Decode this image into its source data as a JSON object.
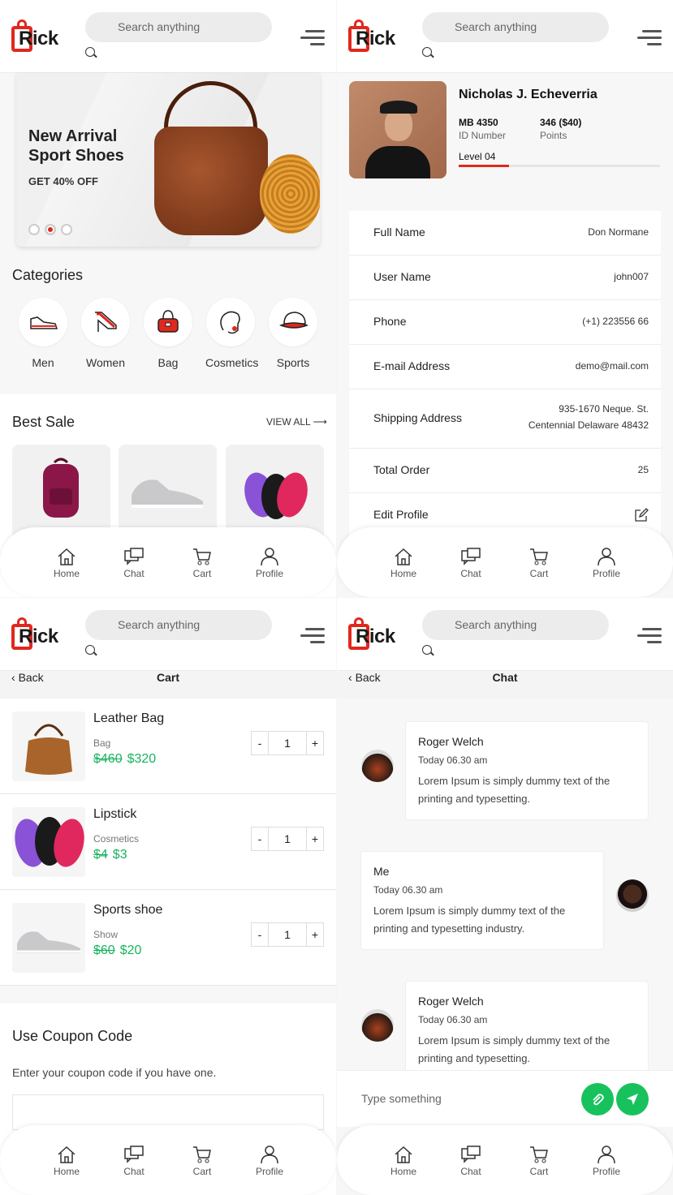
{
  "brand": {
    "logo_text": "Rick"
  },
  "search": {
    "placeholder": "Search anything"
  },
  "nav": {
    "home": "Home",
    "chat": "Chat",
    "cart": "Cart",
    "profile": "Profile"
  },
  "home": {
    "banner": {
      "title": "New Arrival Sport Shoes",
      "subtitle": "GET 40% OFF",
      "active_slide": 2,
      "slide_count": 3
    },
    "categories_title": "Categories",
    "categories": [
      {
        "label": "Men",
        "icon": "shoe-icon"
      },
      {
        "label": "Women",
        "icon": "heel-icon"
      },
      {
        "label": "Bag",
        "icon": "bag-icon"
      },
      {
        "label": "Cosmetics",
        "icon": "face-icon"
      },
      {
        "label": "Sports",
        "icon": "cap-icon"
      }
    ],
    "best_sale_title": "Best Sale",
    "view_all": "VIEW ALL ⟶"
  },
  "profile": {
    "name": "Nicholas J. Echeverria",
    "id_value": "MB 4350",
    "id_label": "ID Number",
    "points_value": "346 ($40)",
    "points_label": "Points",
    "level": "Level 04",
    "level_progress": 0.25,
    "rows": [
      {
        "label": "Full Name",
        "value": "Don Normane"
      },
      {
        "label": "User Name",
        "value": "john007"
      },
      {
        "label": "Phone",
        "value": "(+1) 223556 66"
      },
      {
        "label": "E-mail Address",
        "value": "demo@mail.com"
      },
      {
        "label": "Shipping Address",
        "value_line1": "935-1670 Neque. St.",
        "value_line2": "Centennial Delaware 48432"
      },
      {
        "label": "Total Order",
        "value": "25"
      },
      {
        "label": "Edit Profile",
        "icon": "edit-icon"
      }
    ]
  },
  "cart": {
    "back": "Back",
    "title": "Cart",
    "items": [
      {
        "name": "Leather Bag",
        "category": "Bag",
        "old_price": "$460",
        "price": "$320",
        "qty": "1"
      },
      {
        "name": "Lipstick",
        "category": "Cosmetics",
        "old_price": "$4",
        "price": "$3",
        "qty": "1"
      },
      {
        "name": "Sports shoe",
        "category": "Show",
        "old_price": "$60",
        "price": "$20",
        "qty": "1"
      }
    ],
    "minus": "-",
    "plus": "+",
    "coupon_title": "Use Coupon Code",
    "coupon_text": "Enter your coupon code if you have one."
  },
  "chat": {
    "back": "Back",
    "title": "Chat",
    "messages": [
      {
        "who": "Roger Welch",
        "time": "Today 06.30 am",
        "text": "Lorem Ipsum is simply dummy text of the printing and typesetting."
      },
      {
        "who": "Me",
        "time": "Today 06.30 am",
        "text": "Lorem Ipsum is simply dummy text of the printing and typesetting industry."
      },
      {
        "who": "Roger Welch",
        "time": "Today 06.30 am",
        "text": "Lorem Ipsum is simply dummy text of the printing and typesetting."
      }
    ],
    "input_placeholder": "Type something"
  },
  "colors": {
    "accent": "#e0281e",
    "price_green": "#17b35e",
    "send_green": "#17c25c"
  }
}
